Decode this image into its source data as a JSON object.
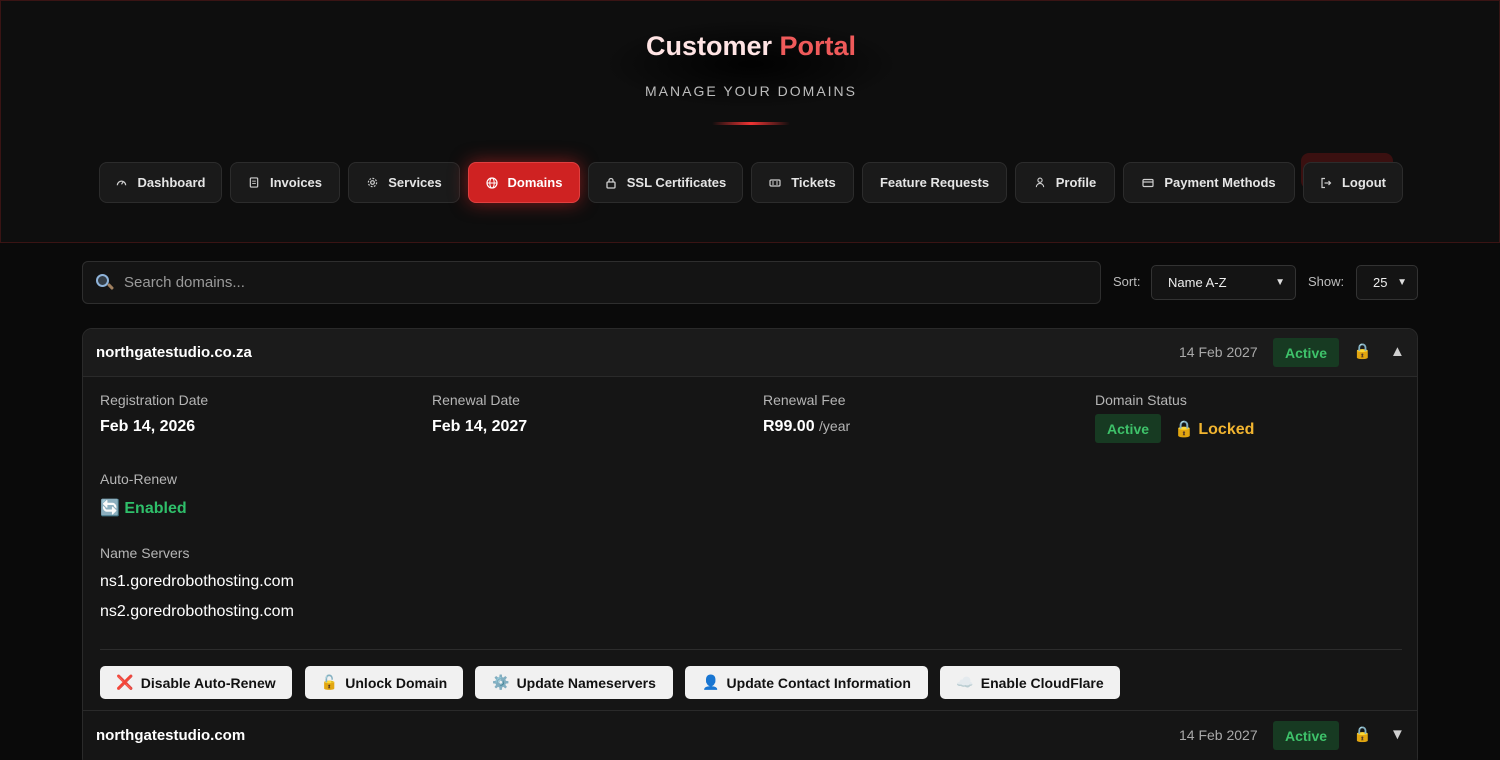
{
  "header": {
    "title_part1": "Customer",
    "title_part2": "Portal",
    "subtitle": "MANAGE YOUR DOMAINS"
  },
  "nav": {
    "items": [
      {
        "label": "Dashboard",
        "icon": "gauge-icon"
      },
      {
        "label": "Invoices",
        "icon": "invoice-icon"
      },
      {
        "label": "Services",
        "icon": "gear-icon"
      },
      {
        "label": "Domains",
        "icon": "globe-icon",
        "active": true
      },
      {
        "label": "SSL Certificates",
        "icon": "lock-icon"
      },
      {
        "label": "Tickets",
        "icon": "ticket-icon"
      },
      {
        "label": "Feature Requests"
      },
      {
        "label": "Profile",
        "icon": "user-icon"
      },
      {
        "label": "Payment Methods",
        "icon": "credit-card-icon"
      },
      {
        "label": "Logout",
        "icon": "logout-icon"
      }
    ]
  },
  "toolbar": {
    "search_placeholder": "Search domains...",
    "sort_label": "Sort:",
    "sort_value": "Name A-Z",
    "show_label": "Show:",
    "show_value": "25"
  },
  "domains": [
    {
      "name": "northgatestudio.co.za",
      "expiry_short": "14 Feb 2027",
      "status": "Active",
      "expanded": true,
      "details": {
        "registration_label": "Registration Date",
        "registration_value": "Feb 14, 2026",
        "renewal_label": "Renewal Date",
        "renewal_value": "Feb 14, 2027",
        "fee_label": "Renewal Fee",
        "fee_value": "R99.00",
        "fee_unit": "/year",
        "status_label": "Domain Status",
        "status_value": "Active",
        "lock_status": "Locked",
        "autorenew_label": "Auto-Renew",
        "autorenew_value": "Enabled",
        "ns_label": "Name Servers",
        "ns1": "ns1.goredrobothosting.com",
        "ns2": "ns2.goredrobothosting.com"
      },
      "actions": {
        "disable_autorenew": "Disable Auto-Renew",
        "unlock": "Unlock Domain",
        "update_ns": "Update Nameservers",
        "update_contact": "Update Contact Information",
        "cloudflare": "Enable CloudFlare"
      }
    },
    {
      "name": "northgatestudio.com",
      "expiry_short": "14 Feb 2027",
      "status": "Active",
      "expanded": false
    }
  ],
  "colors": {
    "accent": "#cf2222",
    "active_green": "#3ec26a",
    "locked_amber": "#f2b530"
  }
}
